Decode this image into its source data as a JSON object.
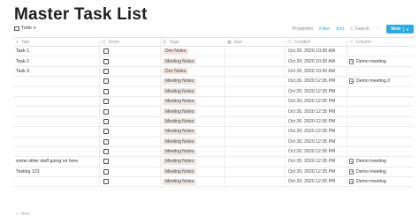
{
  "page": {
    "title": "Master Task List"
  },
  "view": {
    "name": "Todo"
  },
  "toolbar": {
    "properties": "Properties",
    "filter": "Filter",
    "sort": "Sort",
    "search": "Search",
    "more": "···",
    "new": "New"
  },
  "columns": {
    "name": "Tale",
    "done": "Done",
    "tags": "Tags",
    "due": "Due",
    "created": "Created",
    "column": "Column"
  },
  "rows": [
    {
      "name": "Task 1",
      "tag": "Dev Notes",
      "tag_kind": "dev",
      "created": "Oct 20, 2020 10:30 AM",
      "column": ""
    },
    {
      "name": "Task 2",
      "tag": "Meeting Notes",
      "tag_kind": "meeting",
      "created": "Oct 20, 2020 10:30 AM",
      "column": "Demo meeting"
    },
    {
      "name": "Task 3",
      "tag": "Dev Notes",
      "tag_kind": "dev",
      "created": "Oct 20, 2020 10:30 AM",
      "column": ""
    },
    {
      "name": "",
      "tag": "Meeting Notes",
      "tag_kind": "meeting",
      "created": "Oct 20, 2020 12:35 PM",
      "column": "Demo meeting 2"
    },
    {
      "name": "",
      "tag": "Meeting Notes",
      "tag_kind": "meeting",
      "created": "Oct 20, 2020 12:35 PM",
      "column": ""
    },
    {
      "name": "",
      "tag": "Meeting Notes",
      "tag_kind": "meeting",
      "created": "Oct 20, 2020 12:35 PM",
      "column": ""
    },
    {
      "name": "",
      "tag": "Meeting Notes",
      "tag_kind": "meeting",
      "created": "Oct 20, 2020 12:35 PM",
      "column": ""
    },
    {
      "name": "",
      "tag": "Meeting Notes",
      "tag_kind": "meeting",
      "created": "Oct 20, 2020 12:35 PM",
      "column": ""
    },
    {
      "name": "",
      "tag": "Meeting Notes",
      "tag_kind": "meeting",
      "created": "Oct 20, 2020 12:35 PM",
      "column": ""
    },
    {
      "name": "",
      "tag": "Meeting Notes",
      "tag_kind": "meeting",
      "created": "Oct 20, 2020 12:35 PM",
      "column": ""
    },
    {
      "name": "",
      "tag": "Meeting Notes",
      "tag_kind": "meeting",
      "created": "Oct 20, 2020 12:35 PM",
      "column": ""
    },
    {
      "name": "some other stuff going on here",
      "tag": "Meeting Notes",
      "tag_kind": "meeting",
      "created": "Oct 20, 2020 12:35 PM",
      "column": "Demo meeting"
    },
    {
      "name": "Testing 123",
      "tag": "Meeting Notes",
      "tag_kind": "meeting",
      "created": "Oct 20, 2020 12:35 PM",
      "column": "Demo meeting"
    },
    {
      "name": "",
      "tag": "Meeting Notes",
      "tag_kind": "meeting",
      "created": "Oct 20, 2020 12:35 PM",
      "column": "Demo meeting"
    }
  ],
  "footer": {
    "new_label": "New"
  },
  "icons": {
    "view": "table-icon",
    "name_col": "text-icon",
    "done_col": "checkbox-icon",
    "tags_col": "list-icon",
    "due_col": "calendar-icon",
    "created_col": "clock-icon",
    "column_col": "relation-arrow-icon",
    "page": "page-icon"
  },
  "colors": {
    "accent": "#2eaadc",
    "dev_tag": "#f3e3dc",
    "meeting_tag": "#ebe6e2"
  }
}
